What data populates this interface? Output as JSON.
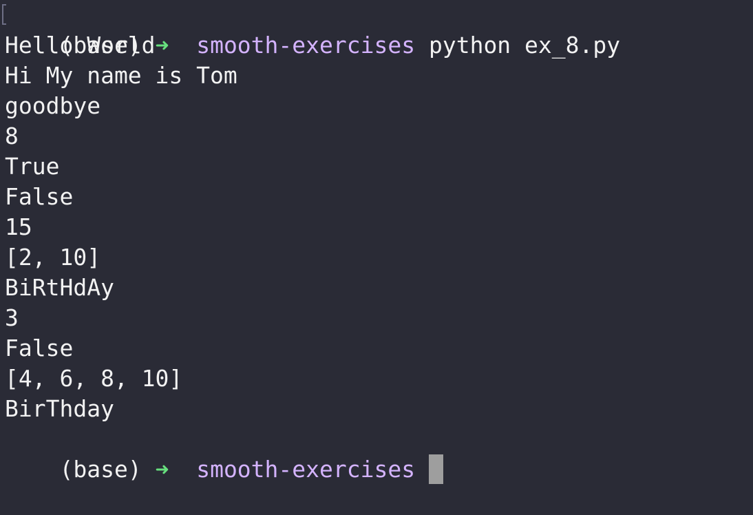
{
  "terminal": {
    "prompt": {
      "env": "(base)",
      "arrow": "➜",
      "directory": "smooth-exercises"
    },
    "command": "python ex_8.py",
    "output": [
      "Hello World",
      "Hi My name is Tom",
      "goodbye",
      "8",
      "True",
      "False",
      "15",
      "[2, 10]",
      "BiRtHdAy",
      "3",
      "False",
      "[4, 6, 8, 10]",
      "BirThday"
    ],
    "colors": {
      "background": "#2a2b36",
      "text": "#f2f2f2",
      "arrow": "#67e07e",
      "directory": "#d4b3ff",
      "cursor": "#9e9e9e"
    }
  }
}
